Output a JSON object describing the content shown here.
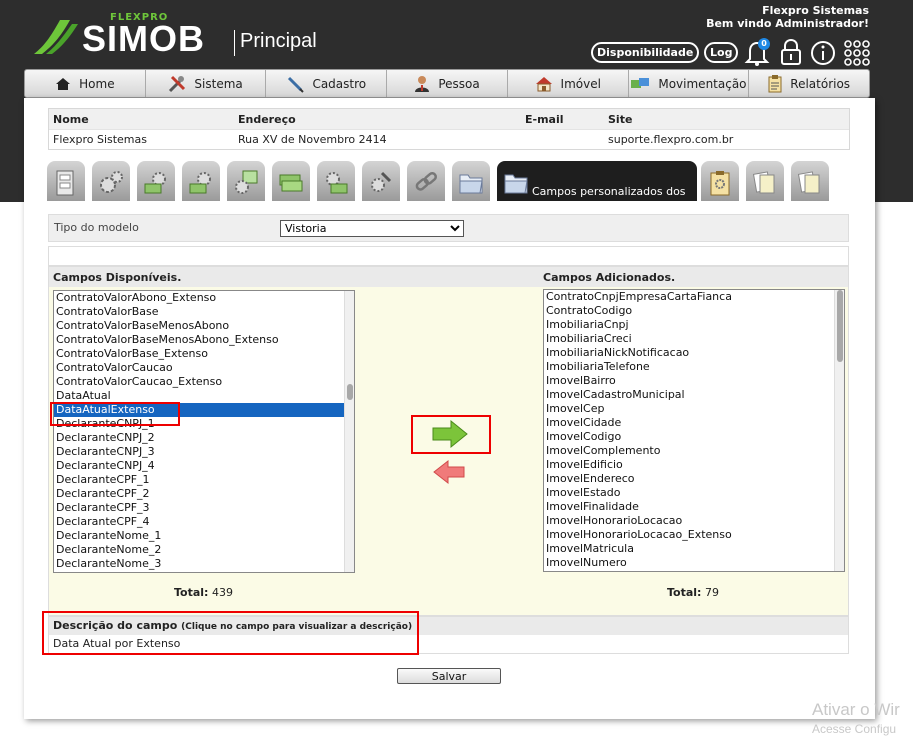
{
  "header": {
    "brand_small": "FLEXPRO",
    "brand": "SIMOB",
    "module": "Principal",
    "company": "Flexpro Sistemas",
    "welcome": "Bem vindo Administrador!",
    "availability_label": "Disponibilidade",
    "log_label": "Log",
    "notification_count": "0",
    "icons": [
      "bell-icon",
      "lock-icon",
      "info-icon",
      "apps-grid-icon"
    ]
  },
  "nav": {
    "items": [
      {
        "label": "Home",
        "icon": "home-icon"
      },
      {
        "label": "Sistema",
        "icon": "tools-icon"
      },
      {
        "label": "Cadastro",
        "icon": "pen-icon"
      },
      {
        "label": "Pessoa",
        "icon": "person-icon"
      },
      {
        "label": "Imóvel",
        "icon": "house-icon"
      },
      {
        "label": "Movimentação",
        "icon": "exchange-icon"
      },
      {
        "label": "Relatórios",
        "icon": "report-icon"
      }
    ]
  },
  "company_table": {
    "headers": [
      "Nome",
      "Endereço",
      "E-mail",
      "Site"
    ],
    "row": [
      "Flexpro Sistemas",
      "Rua XV de Novembro 2414",
      "",
      "suporte.flexpro.com.br"
    ]
  },
  "tabs": {
    "icons": [
      "cabinet-icon",
      "gears-icon",
      "gear-money-icon",
      "gear-money-icon",
      "gear-chart-icon",
      "money-icon",
      "gear-money-icon",
      "gear-tools-icon",
      "chain-icon",
      "folder-icon",
      "folder-icon",
      "clipboard-icon",
      "documents-icon",
      "documents-icon"
    ],
    "active_label": "Campos personalizados dos"
  },
  "model": {
    "label": "Tipo do modelo",
    "value": "Vistoria"
  },
  "available": {
    "title": "Campos Disponíveis.",
    "items": [
      "ContratoValorAbono_Extenso",
      "ContratoValorBase",
      "ContratoValorBaseMenosAbono",
      "ContratoValorBaseMenosAbono_Extenso",
      "ContratoValorBase_Extenso",
      "ContratoValorCaucao",
      "ContratoValorCaucao_Extenso",
      "DataAtual",
      "DataAtualExtenso",
      "DeclaranteCNPJ_1",
      "DeclaranteCNPJ_2",
      "DeclaranteCNPJ_3",
      "DeclaranteCNPJ_4",
      "DeclaranteCPF_1",
      "DeclaranteCPF_2",
      "DeclaranteCPF_3",
      "DeclaranteCPF_4",
      "DeclaranteNome_1",
      "DeclaranteNome_2",
      "DeclaranteNome_3"
    ],
    "selected": "DataAtualExtenso",
    "total_label": "Total:",
    "total": "439"
  },
  "added": {
    "title": "Campos Adicionados.",
    "items": [
      "ContratoCnpjEmpresaCartaFianca",
      "ContratoCodigo",
      "ImobiliariaCnpj",
      "ImobiliariaCreci",
      "ImobiliariaNickNotificacao",
      "ImobiliariaTelefone",
      "ImovelBairro",
      "ImovelCadastroMunicipal",
      "ImovelCep",
      "ImovelCidade",
      "ImovelCodigo",
      "ImovelComplemento",
      "ImovelEdificio",
      "ImovelEndereco",
      "ImovelEstado",
      "ImovelFinalidade",
      "ImovelHonorarioLocacao",
      "ImovelHonorarioLocacao_Extenso",
      "ImovelMatricula",
      "ImovelNumero"
    ],
    "total_label": "Total:",
    "total": "79"
  },
  "description": {
    "title": "Descrição do campo",
    "hint": "(Clique no campo para visualizar a descrição)",
    "value": "Data Atual por Extenso"
  },
  "actions": {
    "save_label": "Salvar",
    "add_icon": "arrow-right-icon",
    "remove_icon": "arrow-left-icon"
  },
  "watermark": {
    "line1": "Ativar o Wir",
    "line2": "Acesse Configu"
  },
  "colors": {
    "header_bg": "#2d2d2d",
    "brand_green": "#6ec63a",
    "selection": "#1565c0",
    "highlight_red": "#e00000",
    "fields_bg": "#fbfbe6"
  }
}
